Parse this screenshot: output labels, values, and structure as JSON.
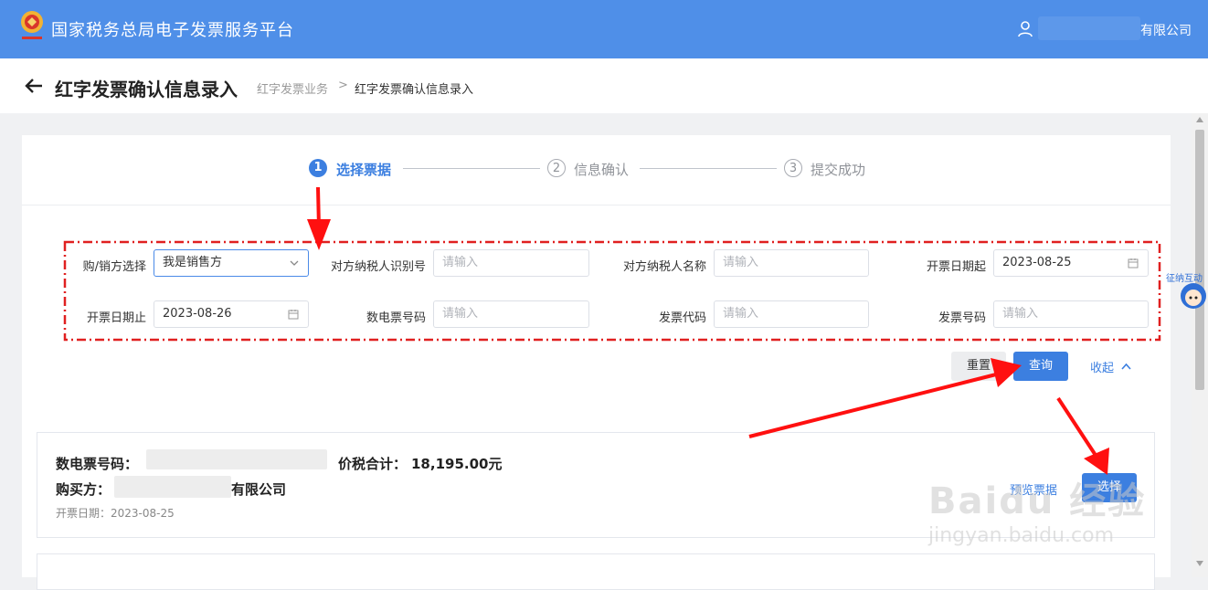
{
  "header": {
    "app_title": "国家税务总局电子发票服务平台",
    "company_suffix": "有限公司",
    "colors": {
      "primary": "#4f8fe8",
      "accent": "#3c7fe0"
    },
    "icons": [
      "emblem-logo",
      "user-icon"
    ]
  },
  "page": {
    "title": "红字发票确认信息录入",
    "breadcrumb": [
      "红字发票业务",
      "红字发票确认信息录入"
    ],
    "breadcrumb_separator": ">"
  },
  "steps": [
    {
      "num": "1",
      "label": "选择票据",
      "active": true
    },
    {
      "num": "2",
      "label": "信息确认",
      "active": false
    },
    {
      "num": "3",
      "label": "提交成功",
      "active": false
    }
  ],
  "filters": {
    "buyer_seller": {
      "label": "购/销方选择",
      "value": "我是销售方"
    },
    "counterparty_tax_id": {
      "label": "对方纳税人识别号",
      "placeholder": "请输入"
    },
    "counterparty_name": {
      "label": "对方纳税人名称",
      "placeholder": "请输入"
    },
    "date_start": {
      "label": "开票日期起",
      "value": "2023-08-25"
    },
    "date_end": {
      "label": "开票日期止",
      "value": "2023-08-26"
    },
    "e_invoice_no": {
      "label": "数电票号码",
      "placeholder": "请输入"
    },
    "invoice_code": {
      "label": "发票代码",
      "placeholder": "请输入"
    },
    "invoice_no": {
      "label": "发票号码",
      "placeholder": "请输入"
    }
  },
  "actions": {
    "reset": "重置",
    "query": "查询",
    "collapse": "收起"
  },
  "result": {
    "e_invoice_label": "数电票号码：",
    "total_label": "价税合计：",
    "total_value": "18,195.00元",
    "buyer_label": "购买方：",
    "buyer_suffix": "有限公司",
    "date_label": "开票日期：",
    "date_value": "2023-08-25",
    "preview": "预览票据",
    "select": "选择"
  },
  "watermark": {
    "brand": "Baidu 经验",
    "url": "jingyan.baidu.com"
  },
  "mascot_text": "征纳互动"
}
